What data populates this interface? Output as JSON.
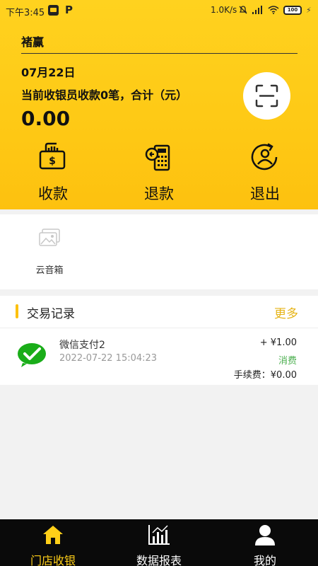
{
  "status_bar": {
    "time": "下午3:45",
    "app_icon_2": "P",
    "net_speed": "1.0K/s",
    "battery": "100"
  },
  "header": {
    "store_name": "褚赢",
    "date": "07月22日",
    "summary": "当前收银员收款0笔，合计（元）",
    "amount": "0.00"
  },
  "actions": [
    {
      "label": "收款",
      "icon": "cash-icon"
    },
    {
      "label": "退款",
      "icon": "refund-icon"
    },
    {
      "label": "退出",
      "icon": "logout-icon"
    }
  ],
  "tools": {
    "speaker_label": "云音箱",
    "speaker_icon": "image-placeholder-icon"
  },
  "records": {
    "title": "交易记录",
    "more": "更多",
    "items": [
      {
        "name": "微信支付2",
        "time": "2022-07-22 15:04:23",
        "amount": "+ ¥1.00",
        "type": "消费",
        "fee": "手续费：¥0.00",
        "icon": "wechat-pay-icon"
      }
    ]
  },
  "tabs": [
    {
      "label": "门店收银",
      "icon": "home-icon",
      "active": true
    },
    {
      "label": "数据报表",
      "icon": "chart-icon",
      "active": false
    },
    {
      "label": "我的",
      "icon": "user-icon",
      "active": false
    }
  ],
  "colors": {
    "accent": "#fdc10f",
    "tab_active": "#ffcf18",
    "success": "#4caf50",
    "wechat": "#1aad19"
  }
}
